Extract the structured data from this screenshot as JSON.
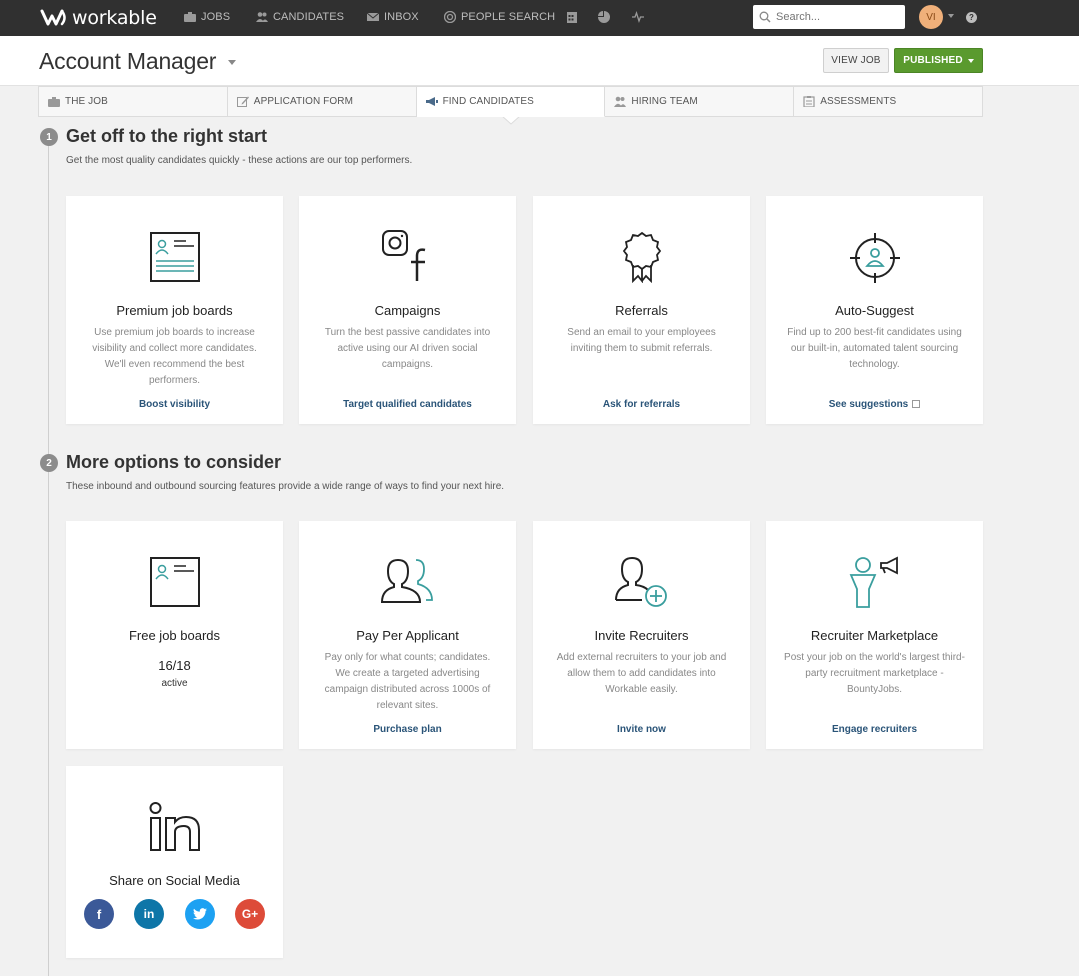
{
  "topnav": {
    "brand": "workable",
    "items": [
      {
        "label": "JOBS",
        "icon": "briefcase-icon"
      },
      {
        "label": "CANDIDATES",
        "icon": "people-icon"
      },
      {
        "label": "INBOX",
        "icon": "envelope-icon"
      },
      {
        "label": "PEOPLE SEARCH",
        "icon": "target-icon"
      }
    ],
    "search_placeholder": "Search...",
    "avatar_initials": "VI",
    "help": "?"
  },
  "header": {
    "job_title": "Account Manager",
    "view_job": "VIEW JOB",
    "published": "PUBLISHED"
  },
  "tabs": [
    {
      "label": "THE JOB",
      "icon": "briefcase-icon"
    },
    {
      "label": "APPLICATION FORM",
      "icon": "edit-icon"
    },
    {
      "label": "FIND CANDIDATES",
      "icon": "megaphone-icon",
      "active": true
    },
    {
      "label": "HIRING TEAM",
      "icon": "team-icon"
    },
    {
      "label": "ASSESSMENTS",
      "icon": "clipboard-icon"
    }
  ],
  "section1": {
    "step": "1",
    "title": "Get off to the right start",
    "subtitle": "Get the most quality candidates quickly - these actions are our top performers.",
    "cards": [
      {
        "title": "Premium job boards",
        "desc": "Use premium job boards to increase visibility and collect more candidates. We'll even recommend the best performers.",
        "link": "Boost visibility"
      },
      {
        "title": "Campaigns",
        "desc": "Turn the best passive candidates into active using our AI driven social campaigns.",
        "link": "Target qualified candidates"
      },
      {
        "title": "Referrals",
        "desc": "Send an email to your employees inviting them to submit referrals.",
        "link": "Ask for referrals"
      },
      {
        "title": "Auto-Suggest",
        "desc": "Find up to 200 best-fit candidates using our built-in, automated talent sourcing technology.",
        "link": "See suggestions"
      }
    ]
  },
  "section2": {
    "step": "2",
    "title": "More options to consider",
    "subtitle": "These inbound and outbound sourcing features provide a wide range of ways to find your next hire.",
    "cards": [
      {
        "title": "Free job boards",
        "count": "16/18",
        "count_label": "active"
      },
      {
        "title": "Pay Per Applicant",
        "desc": "Pay only for what counts; candidates. We create a targeted advertising campaign distributed across 1000s of relevant sites.",
        "link": "Purchase plan"
      },
      {
        "title": "Invite Recruiters",
        "desc": "Add external recruiters to your job and allow them to add candidates into Workable easily.",
        "link": "Invite now"
      },
      {
        "title": "Recruiter Marketplace",
        "desc": "Post your job on the world's largest third-party recruitment marketplace - BountyJobs.",
        "link": "Engage recruiters"
      },
      {
        "title": "Share on Social Media"
      }
    ]
  },
  "social": [
    {
      "name": "facebook",
      "glyph": "f",
      "color": "#3b5998"
    },
    {
      "name": "linkedin",
      "glyph": "in",
      "color": "#0e76a8"
    },
    {
      "name": "twitter",
      "glyph": "t",
      "color": "#1da1f2"
    },
    {
      "name": "google-plus",
      "glyph": "G+",
      "color": "#dd4b39"
    }
  ],
  "colors": {
    "accent": "#5a9a2e",
    "link": "#2a5478",
    "teal": "#3a9e9e"
  }
}
